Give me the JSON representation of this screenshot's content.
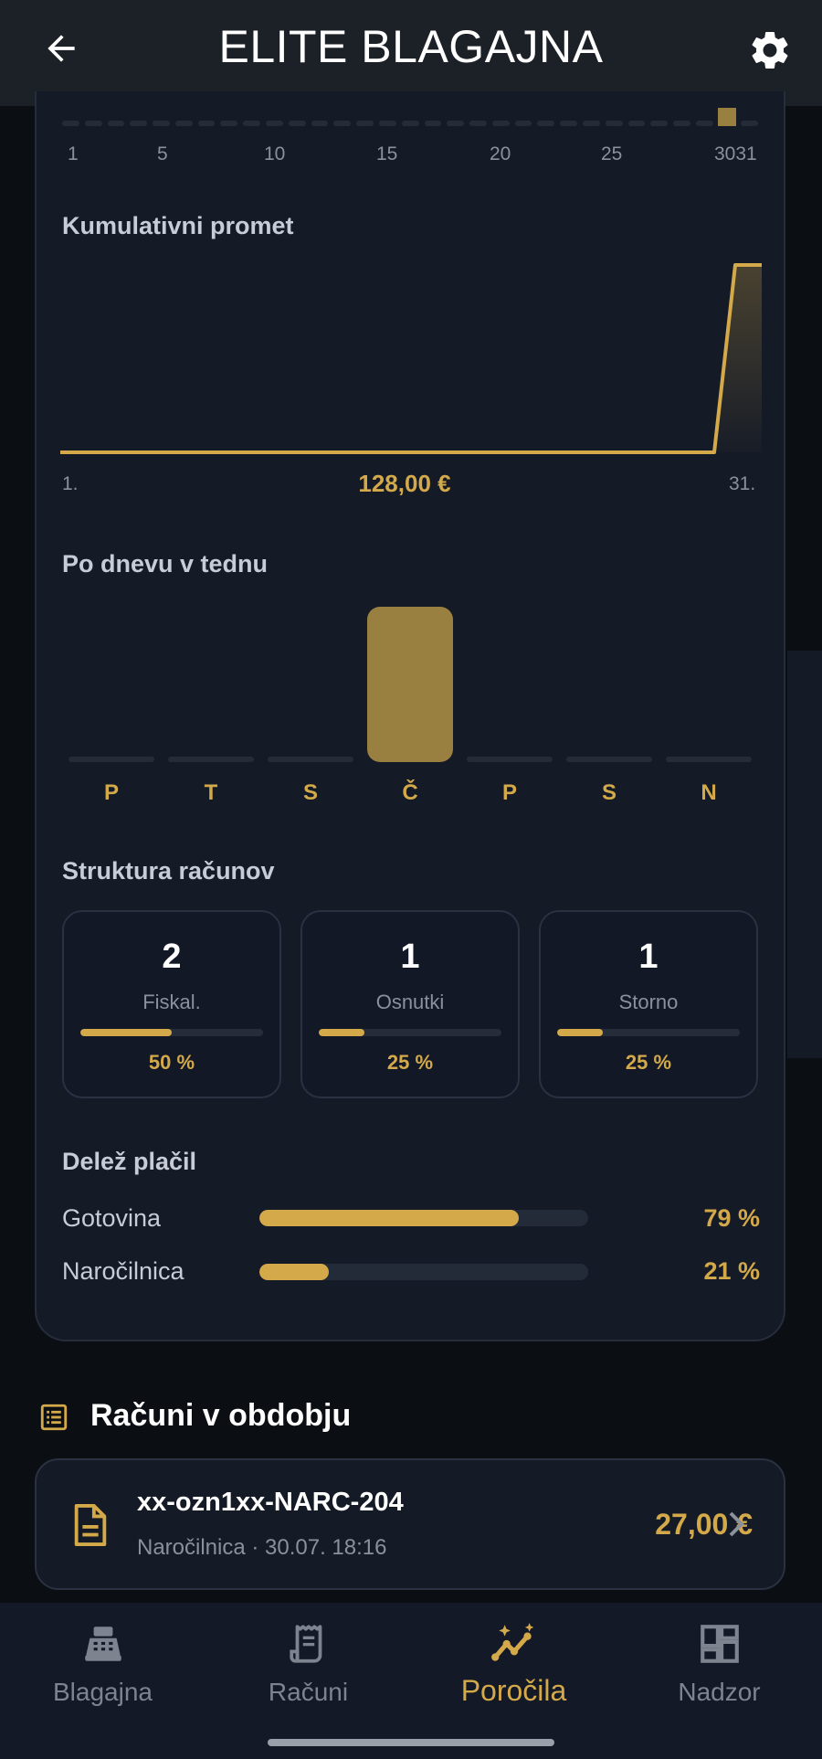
{
  "header": {
    "title": "ELITE BLAGAJNA",
    "back_icon": "arrow-left-icon",
    "settings_icon": "gear-icon"
  },
  "daily_axis": {
    "ticks": [
      "1",
      "5",
      "10",
      "15",
      "20",
      "25",
      "3031"
    ]
  },
  "cumulative": {
    "title": "Kumulativni promet",
    "start_label": "1.",
    "end_label": "31.",
    "total": "128,00 €"
  },
  "weekday": {
    "title": "Po dnevu v tednu",
    "days": [
      "P",
      "T",
      "S",
      "Č",
      "P",
      "S",
      "N"
    ],
    "values": [
      0,
      0,
      0,
      1,
      0,
      0,
      0
    ]
  },
  "structure": {
    "title": "Struktura računov",
    "items": [
      {
        "count": "2",
        "label": "Fiskal.",
        "pct": "50 %",
        "fraction": 0.5
      },
      {
        "count": "1",
        "label": "Osnutki",
        "pct": "25 %",
        "fraction": 0.25
      },
      {
        "count": "1",
        "label": "Storno",
        "pct": "25 %",
        "fraction": 0.25
      }
    ]
  },
  "payments": {
    "title": "Delež plačil",
    "items": [
      {
        "label": "Gotovina",
        "pct": "79 %",
        "fraction": 0.79
      },
      {
        "label": "Naročilnica",
        "pct": "21 %",
        "fraction": 0.21
      }
    ]
  },
  "invoices": {
    "title": "Računi v obdobju",
    "list_icon": "list-icon",
    "items": [
      {
        "number": "xx-ozn1xx-NARC-204",
        "meta": "Naročilnica · 30.07. 18:16",
        "amount": "27,00 €",
        "icon": "document-icon"
      }
    ]
  },
  "nav": {
    "items": [
      {
        "label": "Blagajna",
        "icon": "cash-register-icon"
      },
      {
        "label": "Računi",
        "icon": "receipt-icon"
      },
      {
        "label": "Poročila",
        "icon": "analytics-icon",
        "active": true
      },
      {
        "label": "Nadzor",
        "icon": "dashboard-icon"
      }
    ]
  },
  "colors": {
    "accent": "#d4a94a",
    "card": "#141a26",
    "background": "#0b0e13"
  }
}
